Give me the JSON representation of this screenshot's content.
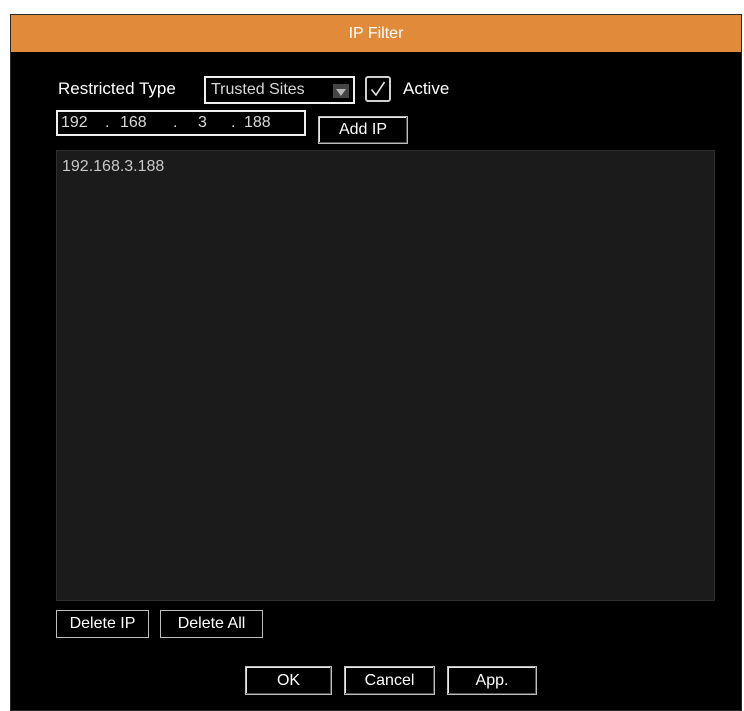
{
  "dialog": {
    "title": "IP Filter"
  },
  "restricted_type": {
    "label": "Restricted Type",
    "selected": "Trusted Sites"
  },
  "active": {
    "label": "Active",
    "checked": true
  },
  "ip_input": {
    "octets": [
      "192",
      "168",
      "3",
      "188"
    ],
    "separator": "."
  },
  "add_ip_label": "Add IP",
  "ip_list": [
    "192.168.3.188"
  ],
  "delete_ip_label": "Delete IP",
  "delete_all_label": "Delete All",
  "ok_label": "OK",
  "cancel_label": "Cancel",
  "apply_label": "App.",
  "colors": {
    "titlebar": "#e08a3a",
    "background": "#000000",
    "list_bg": "#1b1b1b"
  }
}
